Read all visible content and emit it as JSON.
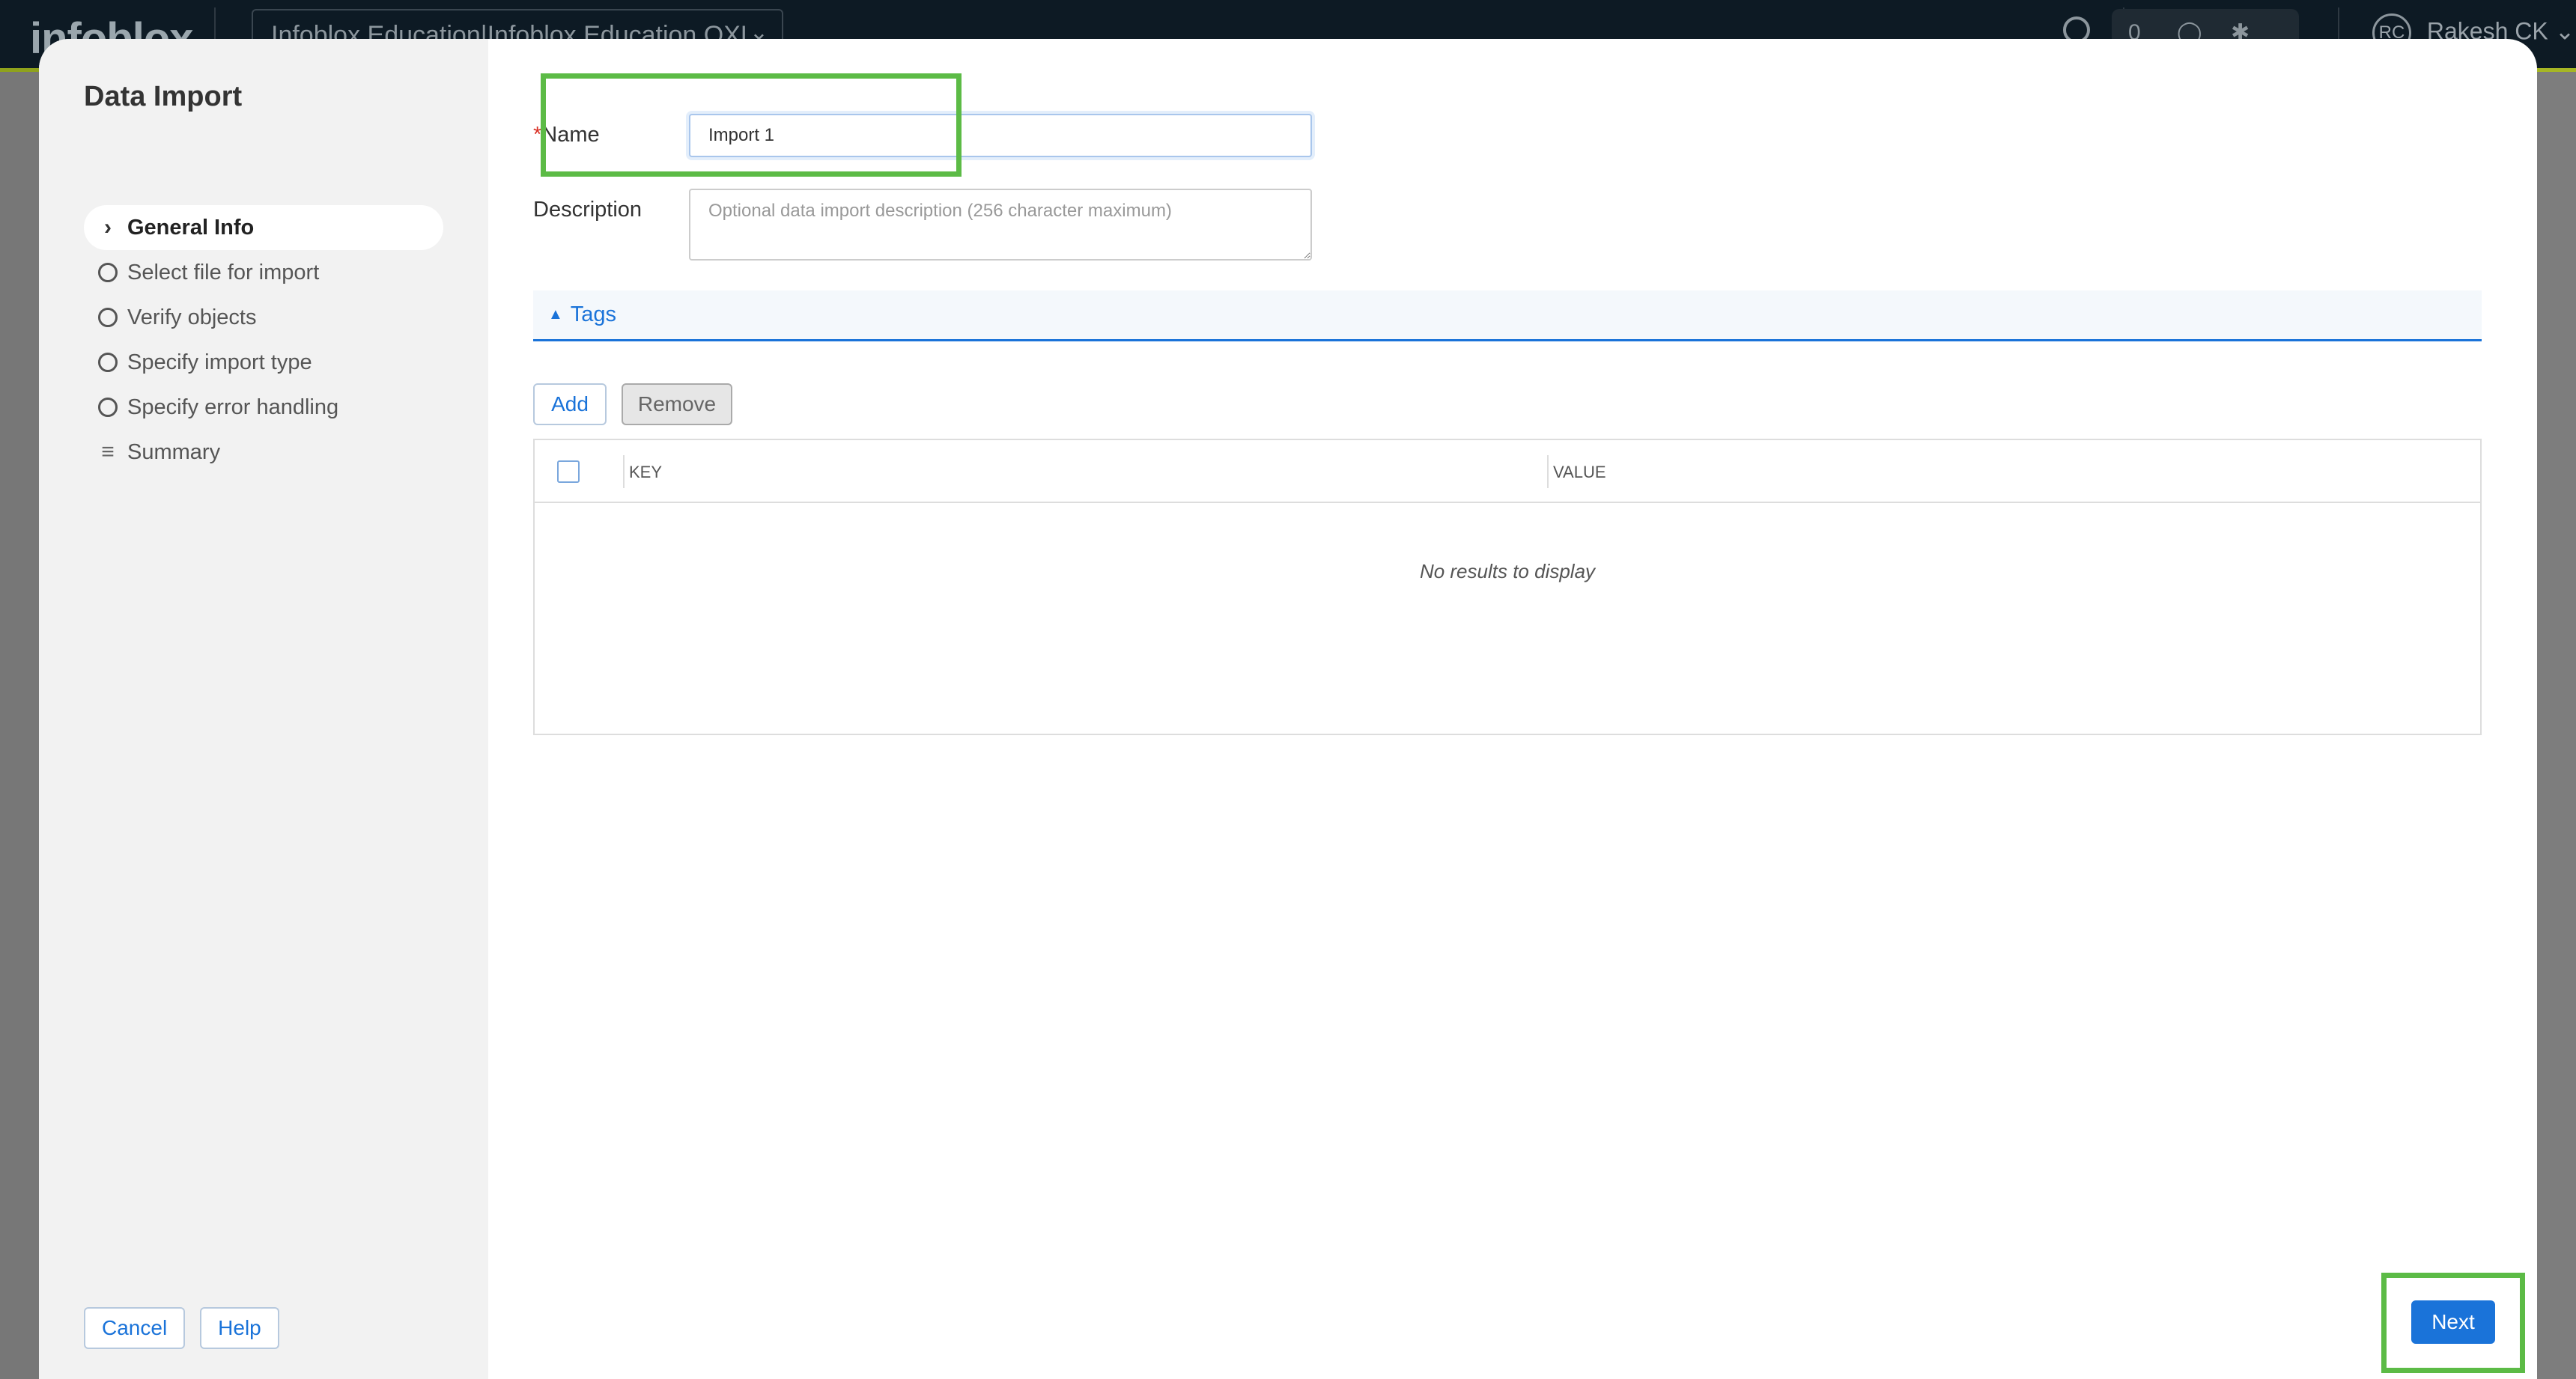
{
  "app": {
    "logo_text": "infoblox",
    "account_selector": "Infoblox Education|Infoblox Education OXL",
    "notification_count": "0",
    "user_initials": "RC",
    "user_name": "Rakesh CK"
  },
  "modal": {
    "title": "Data Import",
    "steps": [
      {
        "label": "General Info",
        "state": "active",
        "icon": "chevron-right-icon"
      },
      {
        "label": "Select file for import",
        "state": "pending",
        "icon": "circle-icon"
      },
      {
        "label": "Verify objects",
        "state": "pending",
        "icon": "circle-icon"
      },
      {
        "label": "Specify import type",
        "state": "pending",
        "icon": "circle-icon"
      },
      {
        "label": "Specify error handling",
        "state": "pending",
        "icon": "circle-icon"
      },
      {
        "label": "Summary",
        "state": "pending",
        "icon": "checklist-icon"
      }
    ],
    "cancel_label": "Cancel",
    "help_label": "Help",
    "next_label": "Next"
  },
  "form": {
    "name_required_mark": "*",
    "name_label": "Name",
    "name_value": "Import 1",
    "description_label": "Description",
    "description_placeholder": "Optional data import description (256 character maximum)",
    "tags_label": "Tags",
    "add_label": "Add",
    "remove_label": "Remove",
    "table": {
      "columns": [
        "KEY",
        "VALUE"
      ],
      "empty_message": "No results to display"
    }
  },
  "colors": {
    "accent": "#1a73d9",
    "highlight": "#5cbb46",
    "required": "#d93025"
  }
}
